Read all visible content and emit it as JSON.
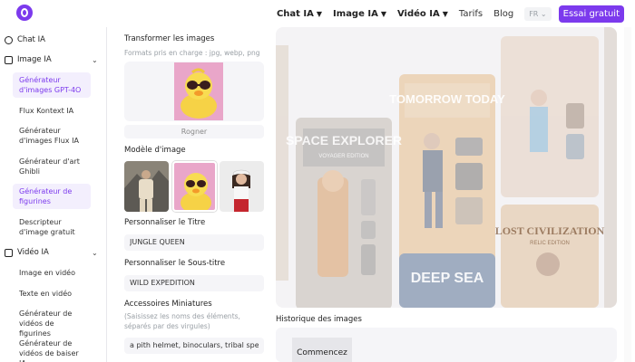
{
  "header": {
    "nav": [
      {
        "label": "Chat IA"
      },
      {
        "label": "Image IA"
      },
      {
        "label": "Vidéo IA"
      }
    ],
    "links": [
      "Tarifs",
      "Blog"
    ],
    "language": "FR",
    "cta": "Essai gratuit"
  },
  "sidebar": {
    "chat": "Chat IA",
    "image_cat": "Image IA",
    "image_items": [
      "Générateur d'images GPT-4O",
      "Flux Kontext IA",
      "Générateur d'images Flux IA",
      "Générateur d'art Ghibli",
      "Générateur de figurines",
      "Descripteur d'image gratuit"
    ],
    "video_cat": "Vidéo IA",
    "video_items": [
      "Image en vidéo",
      "Texte en vidéo",
      "Générateur de vidéos de figurines",
      "Générateur de vidéos de baiser IA"
    ]
  },
  "form": {
    "transform_label": "Transformer les images",
    "formats_hint": "Formats pris en charge : jpg, webp, png",
    "crop_button": "Rogner",
    "template_label": "Modèle d'image",
    "title_label": "Personnaliser le Titre",
    "title_value": "JUNGLE QUEEN",
    "subtitle_label": "Personnaliser le Sous-titre",
    "subtitle_value": "WILD EXPEDITION",
    "accessories_label": "Accessoires Miniatures",
    "accessories_hint_1": "(Saisissez les noms des éléments,",
    "accessories_hint_2": "séparés par des virgules)",
    "accessories_value": "a pith helmet, binoculars, tribal spear"
  },
  "preview": {
    "card1_title": "SPACE EXPLORER",
    "card1_sub": "VOYAGER EDITION",
    "card2_title": "TOMORROW TODAY",
    "card3_title": "LOST CIVILIZATION",
    "card3_sub": "RELIC EDITION",
    "card4_title": "DEEP SEA"
  },
  "history": {
    "title": "Historique des images",
    "start_button": "Commencez"
  },
  "colors": {
    "accent": "#7c3aed",
    "active_bg": "#f3effd"
  }
}
